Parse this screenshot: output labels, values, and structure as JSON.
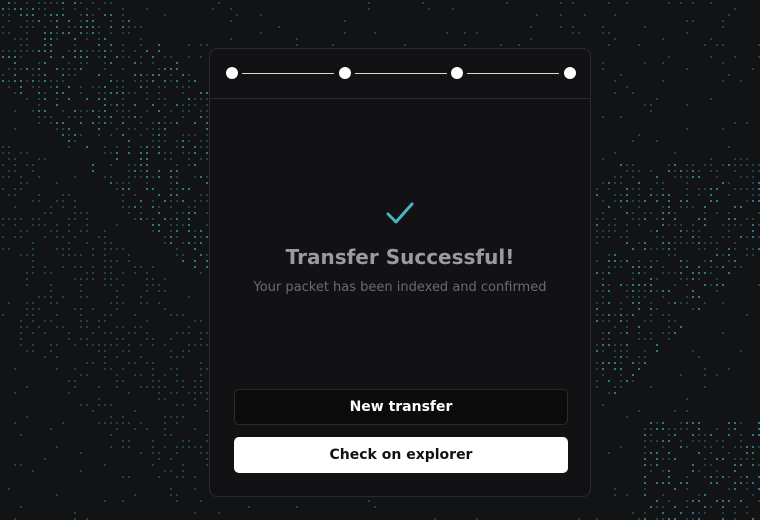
{
  "stepper": {
    "steps": 4,
    "completed": 4
  },
  "status": {
    "icon": "checkmark-icon",
    "title": "Transfer Successful!",
    "subtitle": "Your packet has been indexed and confirmed"
  },
  "actions": {
    "new_transfer": "New transfer",
    "check_explorer": "Check on explorer"
  },
  "colors": {
    "background": "#121314",
    "card": "#121214",
    "accent": "#4bb3c6",
    "title": "#9b9b9e",
    "subtitle": "#6a6b6e"
  }
}
